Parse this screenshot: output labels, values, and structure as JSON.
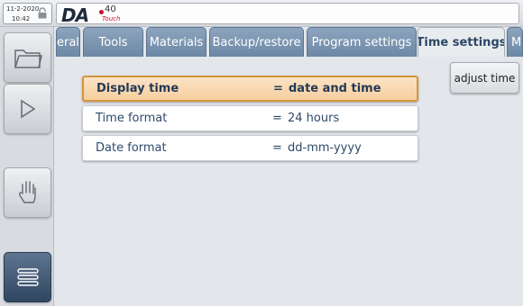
{
  "status": {
    "date": "11-2-2020",
    "time": "10:42"
  },
  "logo": {
    "brand": "DA",
    "model": "40",
    "suffix": "Touch"
  },
  "sidebar": [
    {
      "icon": "folder-icon"
    },
    {
      "icon": "play-icon"
    },
    {
      "icon": "hand-icon"
    },
    {
      "icon": "list-icon",
      "active": true
    }
  ],
  "tabs": [
    {
      "label": "eral"
    },
    {
      "label": "Tools"
    },
    {
      "label": "Materials"
    },
    {
      "label": "Backup/restore"
    },
    {
      "label": "Program settings"
    },
    {
      "label": "Time settings",
      "active": true
    },
    {
      "label": "M"
    }
  ],
  "settings": [
    {
      "label": "Display time",
      "eq": "=",
      "value": "date and time",
      "selected": true
    },
    {
      "label": "Time format",
      "eq": "=",
      "value": "24 hours"
    },
    {
      "label": "Date format",
      "eq": "=",
      "value": "dd-mm-yyyy"
    }
  ],
  "actions": {
    "adjust_time": "adjust time"
  },
  "colors": {
    "tab": "#7b93ae",
    "active_tab_text": "#2c4865",
    "selected_row": "#f7cf9e",
    "selected_border": "#d7963f"
  }
}
